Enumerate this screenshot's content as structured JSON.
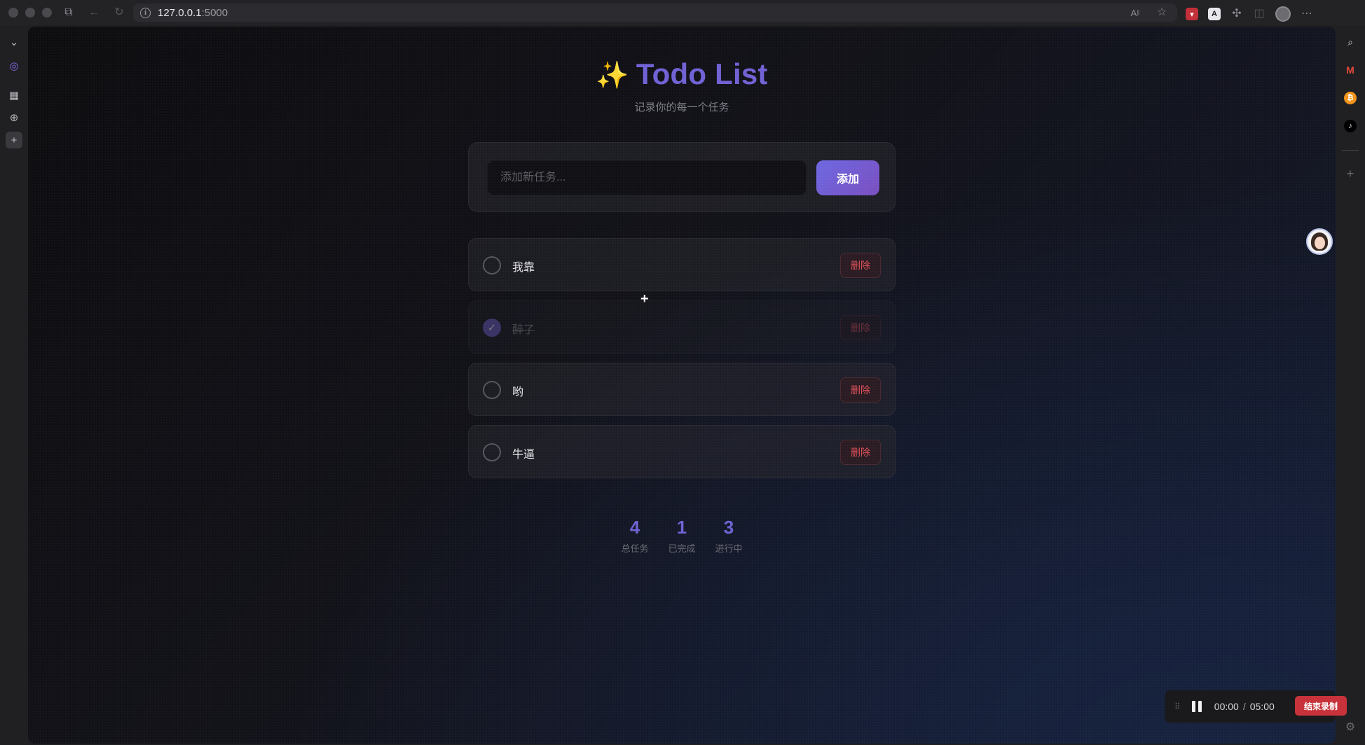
{
  "browser": {
    "url_host": "127.0.0.1",
    "url_port": ":5000"
  },
  "app": {
    "title": "Todo List",
    "sparkle": "✨",
    "subtitle": "记录你的每一个任务",
    "input": {
      "placeholder": "添加新任务...",
      "value": ""
    },
    "add_label": "添加",
    "delete_label": "删除",
    "todos": [
      {
        "text": "我靠",
        "done": false
      },
      {
        "text": "醉了",
        "done": true
      },
      {
        "text": "哟",
        "done": false
      },
      {
        "text": "牛逼",
        "done": false
      }
    ],
    "stats": [
      {
        "value": "4",
        "label": "总任务"
      },
      {
        "value": "1",
        "label": "已完成"
      },
      {
        "value": "3",
        "label": "进行中"
      }
    ]
  },
  "recorder": {
    "elapsed": "00:00",
    "separator": "/",
    "limit": "05:00",
    "stop_label": "结束录制"
  },
  "colors": {
    "accent": "#7062d4",
    "add_button_from": "#6d68e2",
    "add_button_to": "#7a4fbf",
    "danger": "#e0505a",
    "record": "#c8323a"
  },
  "icons": {
    "title": "sparkles-icon",
    "check": "check-icon"
  }
}
